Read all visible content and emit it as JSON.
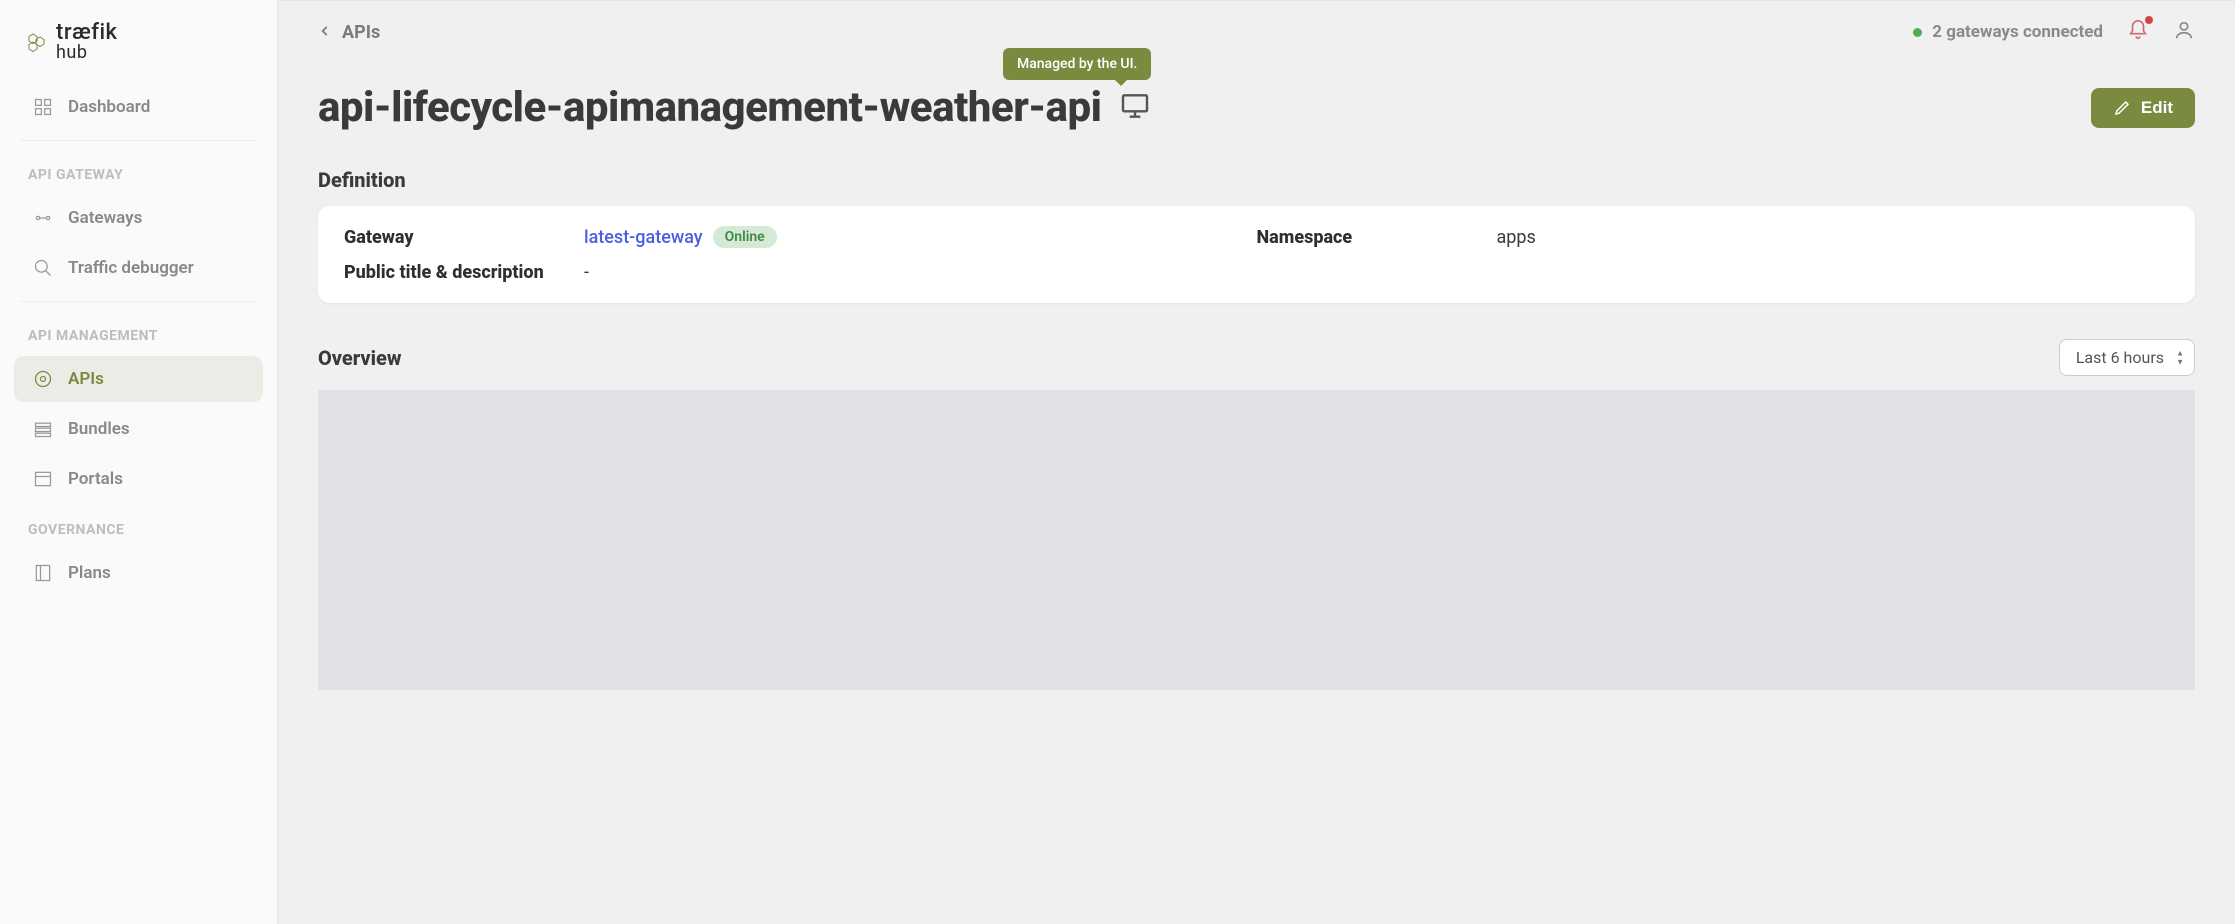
{
  "logo": {
    "line1": "træfik",
    "line2": "hub"
  },
  "sidebar": {
    "dashboard": "Dashboard",
    "section_gateway": "API GATEWAY",
    "gateways": "Gateways",
    "traffic_debugger": "Traffic debugger",
    "section_management": "API MANAGEMENT",
    "apis": "APIs",
    "bundles": "Bundles",
    "portals": "Portals",
    "section_governance": "GOVERNANCE",
    "plans": "Plans"
  },
  "breadcrumb": {
    "back_label": "APIs"
  },
  "status": {
    "text": "2 gateways connected"
  },
  "page": {
    "title": "api-lifecycle-apimanagement-weather-api",
    "tooltip": "Managed by the UI.",
    "edit_label": "Edit"
  },
  "definition": {
    "heading": "Definition",
    "gateway_label": "Gateway",
    "gateway_value": "latest-gateway",
    "gateway_status": "Online",
    "namespace_label": "Namespace",
    "namespace_value": "apps",
    "title_desc_label": "Public title & description",
    "title_desc_value": "-"
  },
  "overview": {
    "heading": "Overview",
    "time_range": "Last 6 hours"
  }
}
